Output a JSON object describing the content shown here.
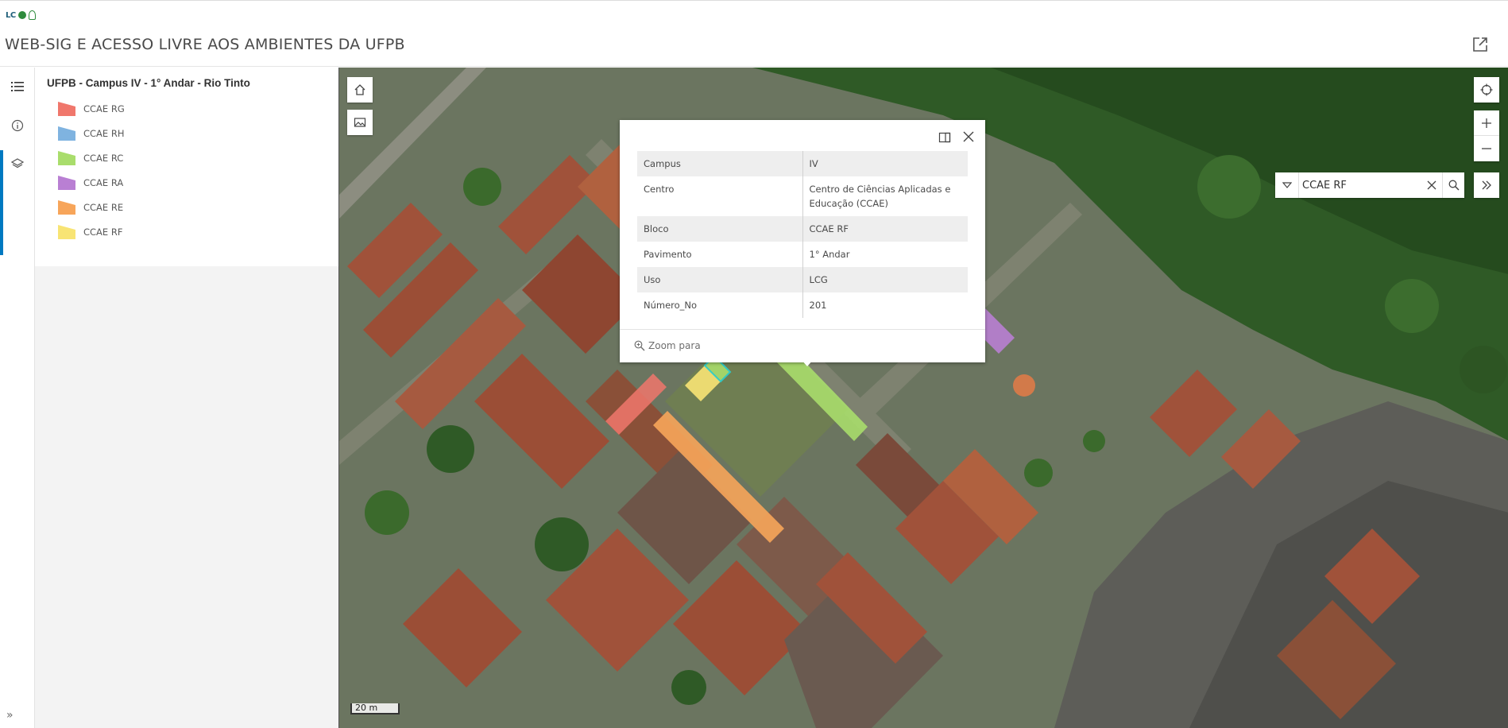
{
  "app": {
    "logo_text": "LC",
    "title": "WEB-SIG E ACESSO LIVRE AOS AMBIENTES DA UFPB"
  },
  "legend": {
    "layer_title": "UFPB - Campus IV - 1° Andar - Rio Tinto",
    "items": [
      {
        "label": "CCAE RG",
        "color": "#f0776c"
      },
      {
        "label": "CCAE RH",
        "color": "#7fb3e0"
      },
      {
        "label": "CCAE RC",
        "color": "#a9dd6c"
      },
      {
        "label": "CCAE RA",
        "color": "#b97fd3"
      },
      {
        "label": "CCAE RE",
        "color": "#f7a55a"
      },
      {
        "label": "CCAE RF",
        "color": "#f8e474"
      }
    ]
  },
  "rail": {
    "icons": [
      "legend-list-icon",
      "info-icon",
      "layers-icon"
    ],
    "expand": "»"
  },
  "search": {
    "value": "CCAE RF"
  },
  "popup": {
    "rows": [
      {
        "key": "Campus",
        "value": "IV"
      },
      {
        "key": "Centro",
        "value": "Centro de Ciências Aplicadas e Educação (CCAE)"
      },
      {
        "key": "Bloco",
        "value": "CCAE RF"
      },
      {
        "key": "Pavimento",
        "value": "1° Andar"
      },
      {
        "key": "Uso",
        "value": "LCG"
      },
      {
        "key": "Número_No",
        "value": "201"
      }
    ],
    "zoom_label": "Zoom para"
  },
  "map": {
    "scale_label": "20 m"
  }
}
